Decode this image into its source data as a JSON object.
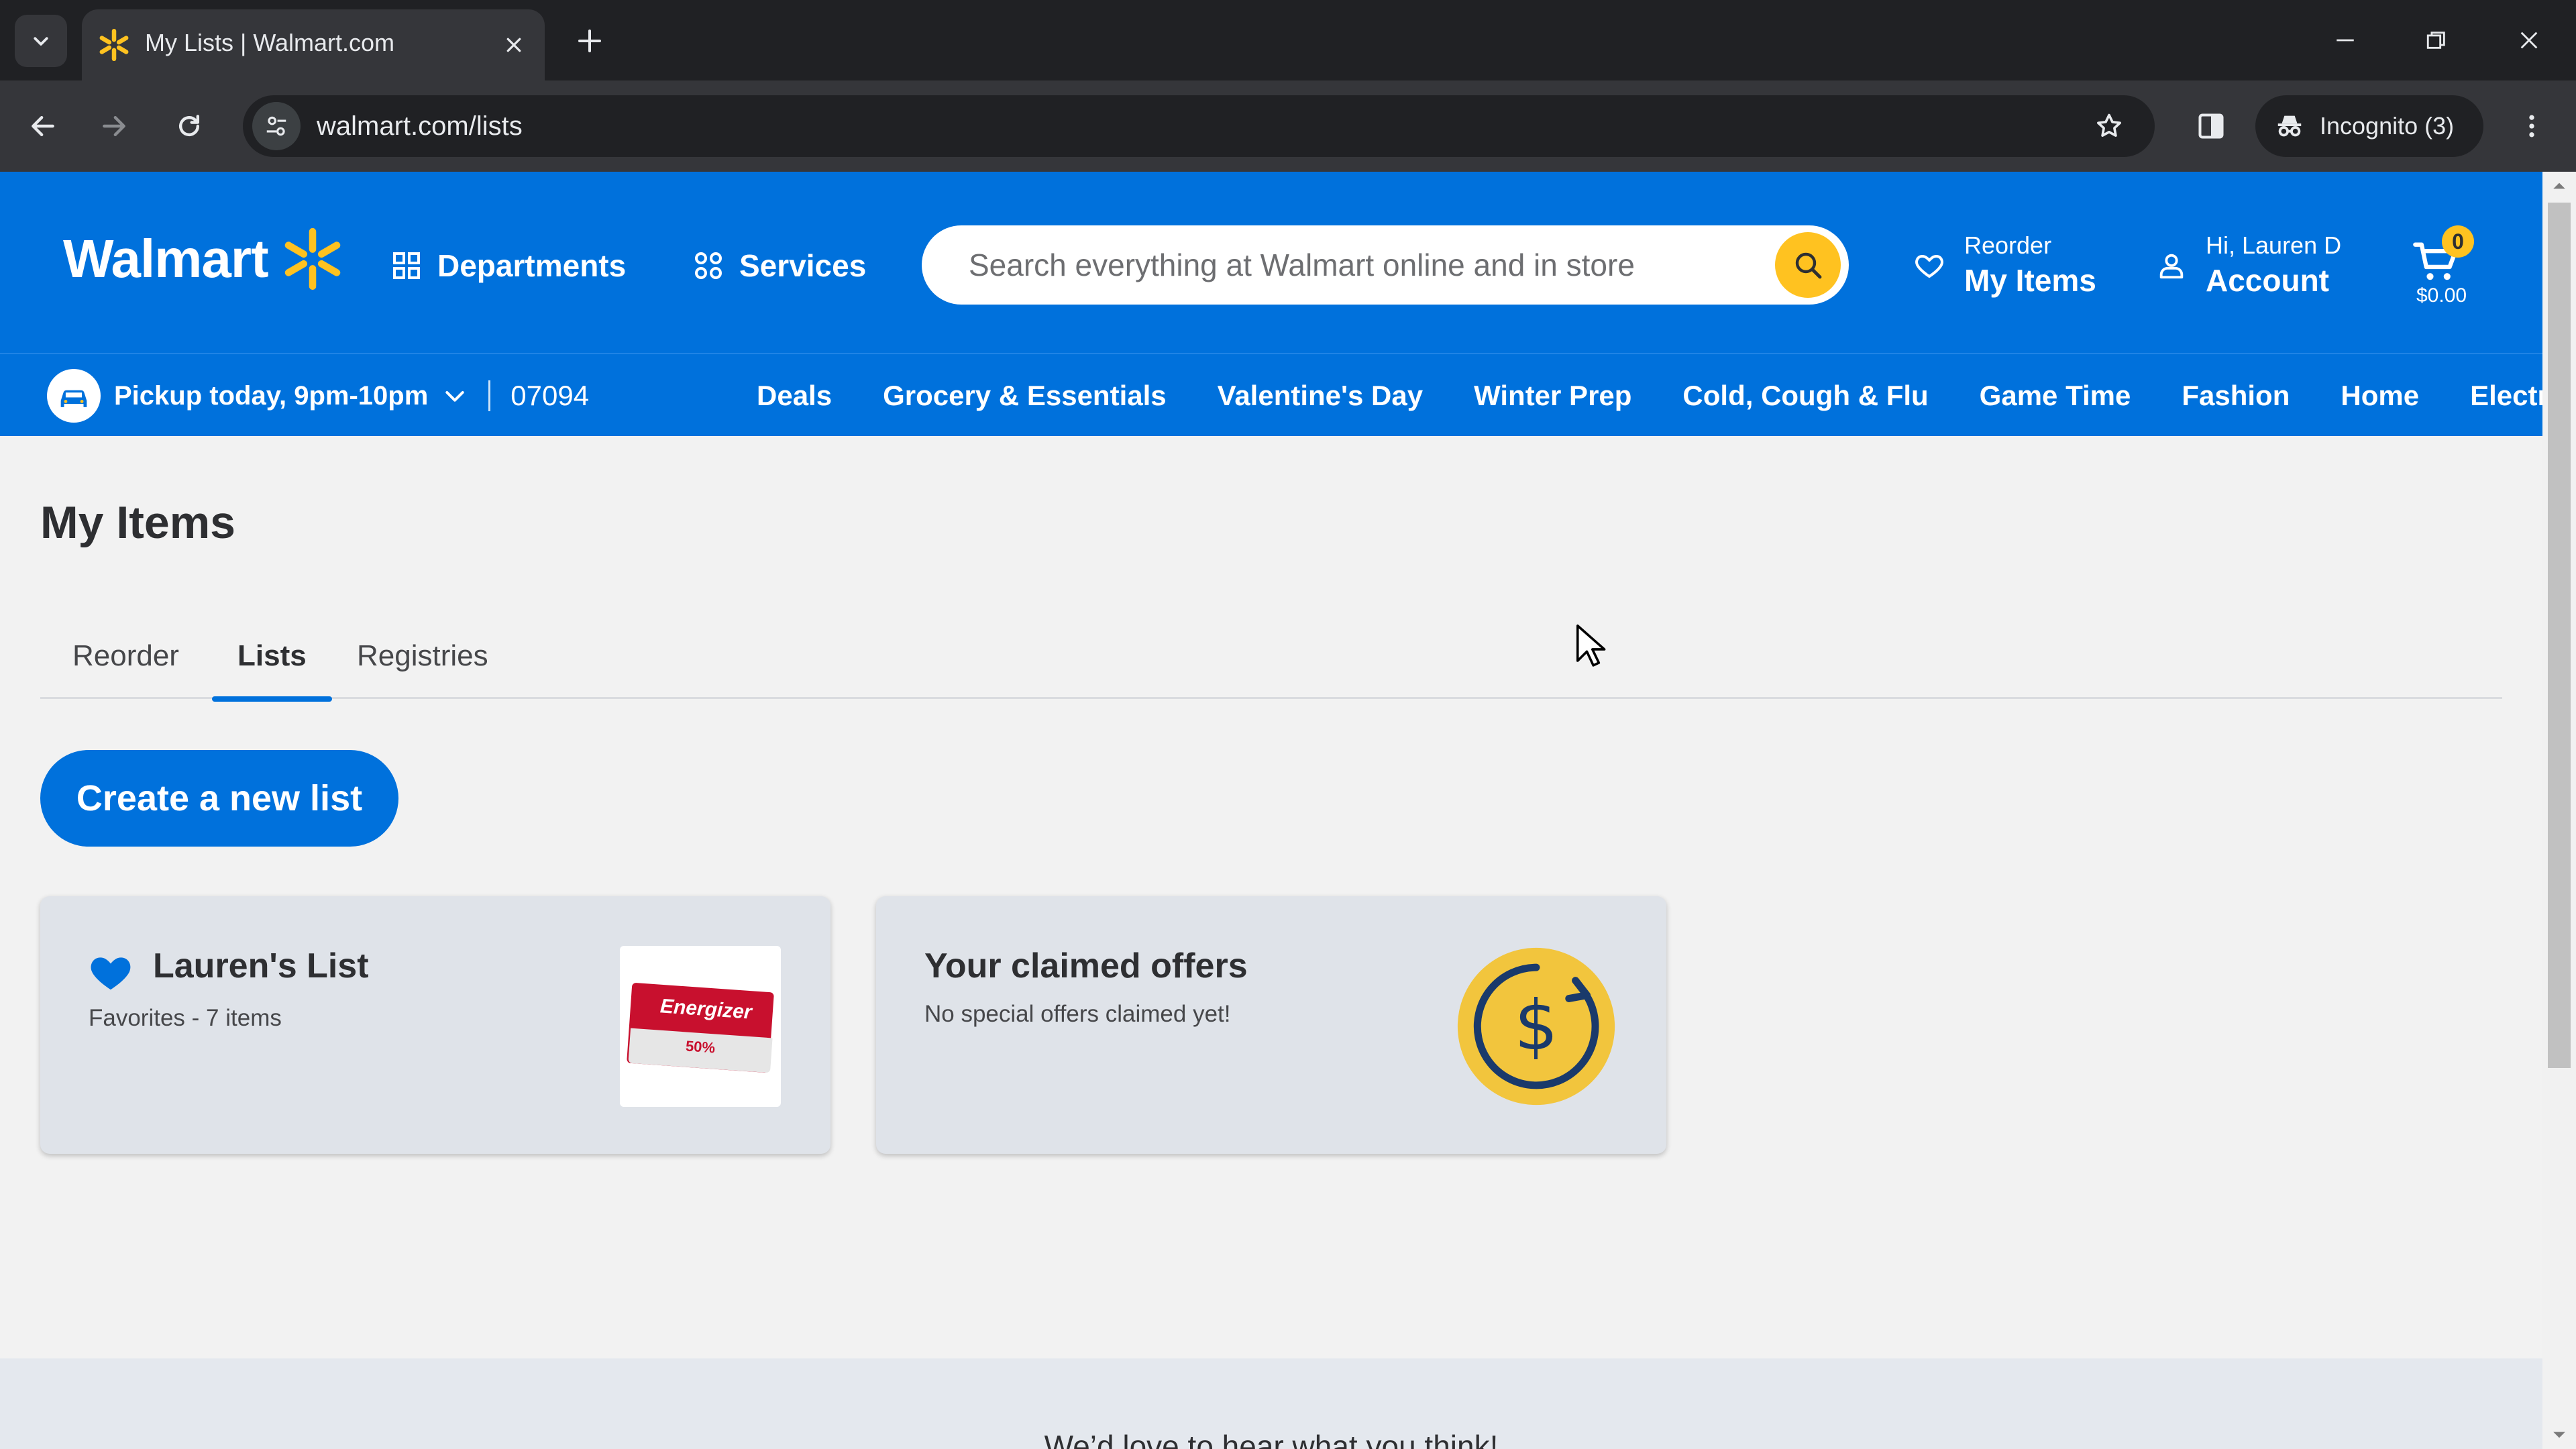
{
  "browser": {
    "tab_title": "My Lists | Walmart.com",
    "url": "walmart.com/lists",
    "incognito_label": "Incognito (3)"
  },
  "header": {
    "logo_text": "Walmart",
    "departments_label": "Departments",
    "services_label": "Services",
    "search_placeholder": "Search everything at Walmart online and in store",
    "reorder_small": "Reorder",
    "reorder_big": "My Items",
    "account_small": "Hi, Lauren D",
    "account_big": "Account",
    "cart_count": "0",
    "cart_total": "$0.00"
  },
  "subnav": {
    "pickup_label": "Pickup today, 9pm-10pm",
    "zip": "07094",
    "categories": [
      "Deals",
      "Grocery & Essentials",
      "Valentine's Day",
      "Winter Prep",
      "Cold, Cough & Flu",
      "Game Time",
      "Fashion",
      "Home",
      "Electronics"
    ]
  },
  "main": {
    "title": "My Items",
    "tabs": [
      {
        "label": "Reorder",
        "active": false
      },
      {
        "label": "Lists",
        "active": true
      },
      {
        "label": "Registries",
        "active": false
      }
    ],
    "create_button": "Create a new list",
    "cards": [
      {
        "title": "Lauren's List",
        "subtitle": "Favorites - 7 items",
        "thumb_text": "Energizer",
        "thumb_badge": "50%"
      },
      {
        "title": "Your claimed offers",
        "subtitle": "No special offers claimed yet!"
      }
    ]
  },
  "footer": {
    "feedback_text": "We’d love to hear what you think!"
  },
  "colors": {
    "walmart_blue": "#0071dc",
    "spark_yellow": "#ffc220",
    "page_bg": "#f2f2f2"
  }
}
